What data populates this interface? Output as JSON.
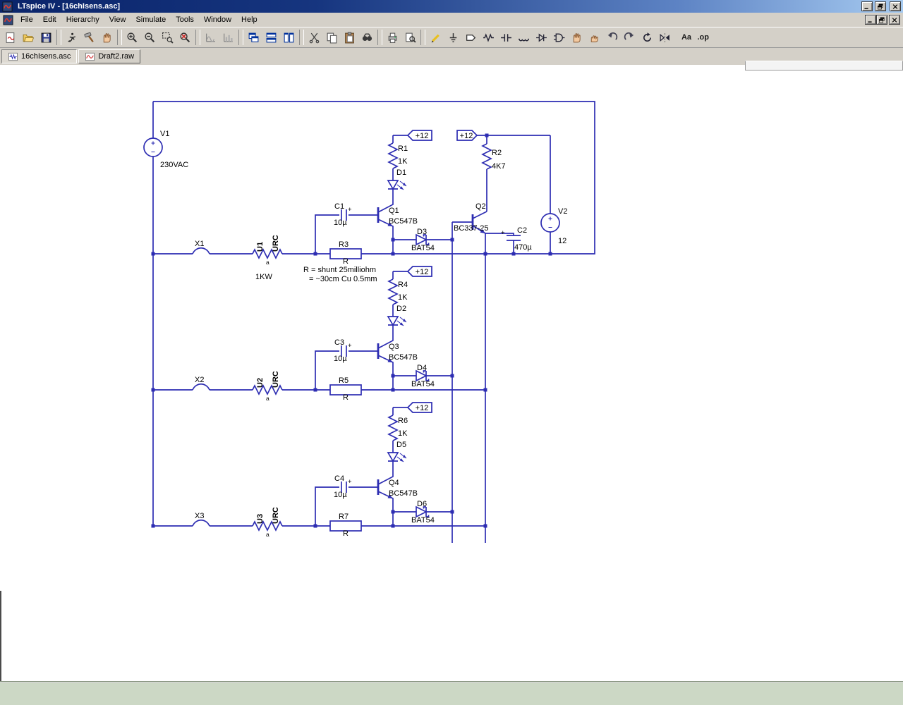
{
  "window": {
    "title": "LTspice IV - [16chIsens.asc]",
    "controls": [
      "minimize",
      "restore",
      "close"
    ]
  },
  "menu": {
    "items": [
      {
        "name": "menu-file",
        "label": "File"
      },
      {
        "name": "menu-edit",
        "label": "Edit"
      },
      {
        "name": "menu-hierarchy",
        "label": "Hierarchy"
      },
      {
        "name": "menu-view",
        "label": "View"
      },
      {
        "name": "menu-simulate",
        "label": "Simulate"
      },
      {
        "name": "menu-tools",
        "label": "Tools"
      },
      {
        "name": "menu-window",
        "label": "Window"
      },
      {
        "name": "menu-help",
        "label": "Help"
      }
    ]
  },
  "toolbar": {
    "items": [
      {
        "kind": "button",
        "name": "new-schematic-button",
        "icon": "#i-new"
      },
      {
        "kind": "button",
        "name": "open-file-button",
        "icon": "#i-open"
      },
      {
        "kind": "button",
        "name": "save-button",
        "icon": "#i-save"
      },
      {
        "kind": "sep",
        "name": "toolbar-separator"
      },
      {
        "kind": "button",
        "name": "run-button",
        "icon": "#i-run"
      },
      {
        "kind": "button",
        "name": "halt-button",
        "icon": "#i-halt"
      },
      {
        "kind": "button",
        "name": "pause-button",
        "icon": "#i-hand"
      },
      {
        "kind": "sep",
        "name": "toolbar-separator"
      },
      {
        "kind": "button",
        "name": "zoom-in-button",
        "icon": "#i-zoomin"
      },
      {
        "kind": "button",
        "name": "zoom-back-button",
        "icon": "#i-zoomout"
      },
      {
        "kind": "button",
        "name": "zoom-area-button",
        "icon": "#i-zoomarea"
      },
      {
        "kind": "button",
        "name": "zoom-full-extents-button",
        "icon": "#i-zoomfull"
      },
      {
        "kind": "sep",
        "name": "toolbar-separator"
      },
      {
        "kind": "button",
        "name": "autorange-y-button",
        "icon": "#i-chart1"
      },
      {
        "kind": "button",
        "name": "plot-settings-button",
        "icon": "#i-chart2"
      },
      {
        "kind": "sep",
        "name": "toolbar-separator"
      },
      {
        "kind": "button",
        "name": "cascade-windows-button",
        "icon": "#i-cascade"
      },
      {
        "kind": "button",
        "name": "tile-horizontal-button",
        "icon": "#i-tileh"
      },
      {
        "kind": "button",
        "name": "tile-vertical-button",
        "icon": "#i-tilev"
      },
      {
        "kind": "sep",
        "name": "toolbar-separator"
      },
      {
        "kind": "button",
        "name": "cut-button",
        "icon": "#i-cut"
      },
      {
        "kind": "button",
        "name": "copy-button",
        "icon": "#i-copy"
      },
      {
        "kind": "button",
        "name": "paste-button",
        "icon": "#i-paste"
      },
      {
        "kind": "button",
        "name": "find-button",
        "icon": "#i-find"
      },
      {
        "kind": "sep",
        "name": "toolbar-separator"
      },
      {
        "kind": "button",
        "name": "print-button",
        "icon": "#i-print"
      },
      {
        "kind": "button",
        "name": "print-preview-button",
        "icon": "#i-preview"
      },
      {
        "kind": "sep",
        "name": "toolbar-separator"
      },
      {
        "kind": "button",
        "name": "draw-wire-button",
        "icon": "#i-wire"
      },
      {
        "kind": "button",
        "name": "ground-button",
        "icon": "#i-gnd"
      },
      {
        "kind": "button",
        "name": "label-net-button",
        "icon": "#i-label"
      },
      {
        "kind": "button",
        "name": "resistor-button",
        "icon": "#i-res"
      },
      {
        "kind": "button",
        "name": "capacitor-button",
        "icon": "#i-cap"
      },
      {
        "kind": "button",
        "name": "inductor-button",
        "icon": "#i-ind"
      },
      {
        "kind": "button",
        "name": "diode-button",
        "icon": "#i-diode"
      },
      {
        "kind": "button",
        "name": "component-button",
        "icon": "#i-comp"
      },
      {
        "kind": "button",
        "name": "move-button",
        "icon": "#i-move"
      },
      {
        "kind": "button",
        "name": "drag-button",
        "icon": "#i-drag"
      },
      {
        "kind": "button",
        "name": "undo-button",
        "icon": "#i-undo"
      },
      {
        "kind": "button",
        "name": "redo-button",
        "icon": "#i-redo"
      },
      {
        "kind": "button",
        "name": "rotate-button",
        "icon": "#i-rotate"
      },
      {
        "kind": "button",
        "name": "mirror-button",
        "icon": "#i-mirror"
      },
      {
        "kind": "button",
        "name": "text-button",
        "glyph": "Aa"
      },
      {
        "kind": "button",
        "name": "spice-directive-button",
        "glyph": ".op"
      }
    ]
  },
  "tabs": [
    {
      "name": "tab-16chisens",
      "label": "16chIsens.asc",
      "icon": "#i-doc-sch",
      "active": true
    },
    {
      "name": "tab-draft2",
      "label": "Draft2.raw",
      "icon": "#i-doc-wave",
      "active": false
    }
  ],
  "schematic": {
    "plus": "+",
    "flag12": "+12",
    "v1": {
      "ref": "V1",
      "value": "230VAC"
    },
    "v2": {
      "ref": "V2",
      "value": "12"
    },
    "r2": {
      "ref": "R2",
      "value": "4K7"
    },
    "q2": {
      "ref": "Q2",
      "type": "BC337-25"
    },
    "c2": {
      "ref": "C2",
      "value": "470µ"
    },
    "u1_power": "1KW",
    "note_line1": "R = shunt 25milliohm",
    "note_line2": "= ~30cm Cu 0.5mm",
    "channels": [
      {
        "fuse": "X1",
        "u_ref": "U1",
        "u_type": "URC",
        "u_pin": "a",
        "shunt_ref": "R3",
        "shunt_val": "R",
        "cap_ref": "C1",
        "cap_val": "10µ",
        "q_ref": "Q1",
        "q_type": "BC547B",
        "r_ref": "R1",
        "r_val": "1K",
        "led_ref": "D1",
        "sense_ref": "D3",
        "sense_val": "BAT54",
        "flag": "+12"
      },
      {
        "fuse": "X2",
        "u_ref": "U2",
        "u_type": "URC",
        "u_pin": "a",
        "shunt_ref": "R5",
        "shunt_val": "R",
        "cap_ref": "C3",
        "cap_val": "10µ",
        "q_ref": "Q3",
        "q_type": "BC547B",
        "r_ref": "R4",
        "r_val": "1K",
        "led_ref": "D2",
        "sense_ref": "D4",
        "sense_val": "BAT54",
        "flag": "+12"
      },
      {
        "fuse": "X3",
        "u_ref": "U3",
        "u_type": "URC",
        "u_pin": "a",
        "shunt_ref": "R7",
        "shunt_val": "R",
        "cap_ref": "C4",
        "cap_val": "10µ",
        "q_ref": "Q4",
        "q_type": "BC547B",
        "r_ref": "R6",
        "r_val": "1K",
        "led_ref": "D5",
        "sense_ref": "D6",
        "sense_val": "BAT54",
        "flag": "+12"
      }
    ]
  },
  "colors": {
    "wire": "#2d2db2",
    "text": "#000000",
    "canvas": "#ffffff",
    "chrome": "#d4d0c8",
    "title_left": "#0a246a",
    "title_right": "#a6caf0",
    "status": "#ccd8c5"
  }
}
